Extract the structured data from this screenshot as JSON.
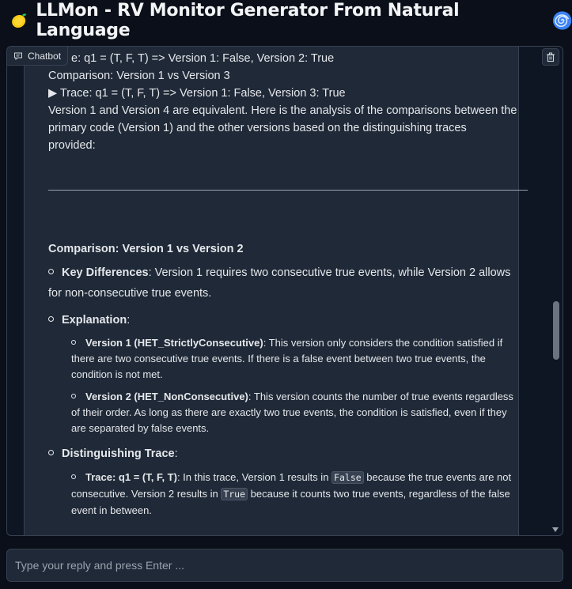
{
  "header": {
    "title": "LLMon - RV Monitor Generator From Natural Language"
  },
  "chatbot": {
    "label": "Chatbot",
    "lines": {
      "l1": "e: q1 = (T, F, T) => Version 1: False, Version 2: True",
      "l2": "Comparison: Version 1 vs Version 3",
      "l3": "▶  Trace: q1 = (T, F, T) => Version 1: False, Version 3: True",
      "l4": "Version 1 and Version 4 are equivalent. Here is the analysis of the comparisons between the",
      "l5": "primary code (Version 1) and the other versions based on the distinguishing traces",
      "l6": "provided:",
      "heading": "Comparison: Version 1 vs Version 2",
      "kd_label": "Key Differences",
      "kd_text_1": ": Version 1 requires two consecutive true events, while Version 2 allows",
      "kd_text_2": "for non-consecutive true events.",
      "expl_label": "Explanation",
      "expl_colon": ":",
      "v1_label": "Version 1 (HET_StrictlyConsecutive)",
      "v1_t1": ": This version only considers the condition satisfied if",
      "v1_t2": "there are two consecutive true events. If there is a false event between two true events, the",
      "v1_t3": "condition is not met.",
      "v2_label": "Version 2 (HET_NonConsecutive)",
      "v2_t1": ": This version counts the number of true events regardless",
      "v2_t2": "of their order. As long as there are exactly two true events, the condition is satisfied, even if they",
      "v2_t3": "are separated by false events.",
      "dt_label": "Distinguishing Trace",
      "dt_colon": ":",
      "tr_label": "Trace: q1 = (T, F, T)",
      "tr_t1a": ": In this trace, Version 1 results in ",
      "tr_code1": "False",
      "tr_t1b": " because the true events are not",
      "tr_t2a": "consecutive. Version 2 results in ",
      "tr_code2": "True",
      "tr_t2b": " because it counts two true events, regardless of the false",
      "tr_t3": "event in between."
    }
  },
  "input": {
    "placeholder": "Type your reply and press Enter ..."
  },
  "colors": {
    "background": "#0b0f19",
    "panel": "#1f2937",
    "border": "#374151",
    "text": "#e5e7eb",
    "spiral": "#3b82f6",
    "lemon": "#facc15"
  },
  "icons": [
    "lemon-icon",
    "spiral-icon",
    "chat-icon",
    "trash-icon",
    "scroll-down-icon"
  ]
}
